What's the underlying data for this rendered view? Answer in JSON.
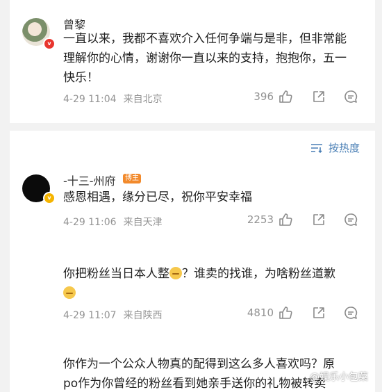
{
  "comment_1": {
    "username": "曾黎",
    "lines": [
      "一直以来，我都不喜欢介入任何争端与是非，但非常能",
      "理解你的心情，谢谢你一直以来的支持，抱抱你，五一",
      "快乐！"
    ],
    "time": "4-29 11:04",
    "location": "来自北京",
    "likes": "396"
  },
  "sort": {
    "label": "按热度",
    "icon": "sort-lines-icon"
  },
  "comment_2": {
    "username": "-十三-州府",
    "badge": "博主",
    "text": "感恩相遇，缘分已尽，祝你平安幸福",
    "time": "4-29 11:06",
    "location": "来自天津",
    "likes": "2253"
  },
  "comment_3": {
    "text_a": "你把粉丝当日本人整",
    "text_b": "？谁卖的找谁，为啥粉丝道歉",
    "time": "4-29 11:07",
    "location": "来自陕西",
    "likes": "4810"
  },
  "comment_4": {
    "lines": [
      "你作为一个公众人物真的配得到这么多人喜欢吗？原",
      "po作为你曾经的粉丝看到她亲手送你的礼物被转卖"
    ]
  },
  "watermark": "@娱乐小包菜",
  "icons": {
    "like": "thumbs-up-icon",
    "share": "share-icon",
    "reply": "comment-icon"
  },
  "colors": {
    "link_blue": "#4a7fb5",
    "meta_gray": "#939393",
    "badge_orange": "#f28a2c"
  }
}
